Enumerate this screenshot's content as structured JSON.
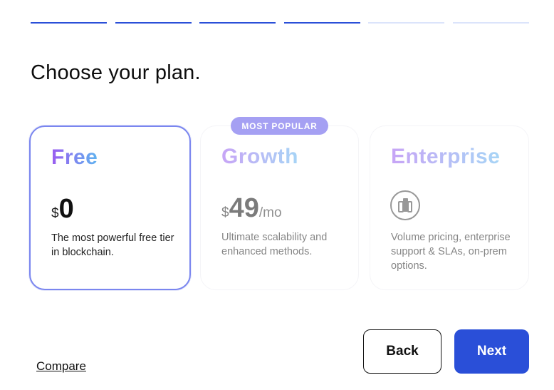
{
  "progress": {
    "total_steps": 6,
    "completed_steps": 4
  },
  "page": {
    "title": "Choose your plan."
  },
  "plans": [
    {
      "name": "Free",
      "currency": "$",
      "amount": "0",
      "period": "",
      "description": "The most powerful free tier in blockchain.",
      "selected": true,
      "gradient": [
        "#9b5cf0",
        "#5fb3f0"
      ]
    },
    {
      "name": "Growth",
      "badge": "MOST POPULAR",
      "currency": "$",
      "amount": "49",
      "period": "/mo",
      "description": "Ultimate scalability and enhanced methods.",
      "selected": false,
      "gradient": [
        "#9b5cf0",
        "#5fb3f0"
      ]
    },
    {
      "name": "Enterprise",
      "icon": "building-icon",
      "description": "Volume pricing, enterprise support & SLAs, on-prem options.",
      "selected": false,
      "gradient": [
        "#9b5cf0",
        "#5fb3f0"
      ]
    }
  ],
  "footer": {
    "compare_label": "Compare",
    "back_label": "Back",
    "next_label": "Next"
  },
  "colors": {
    "accent": "#2a4fd8",
    "progress_done": "#2a4fd8",
    "progress_pending": "#dbe4fb",
    "badge_bg": "#a5a0f3",
    "selected_border": "#7a86ef"
  }
}
